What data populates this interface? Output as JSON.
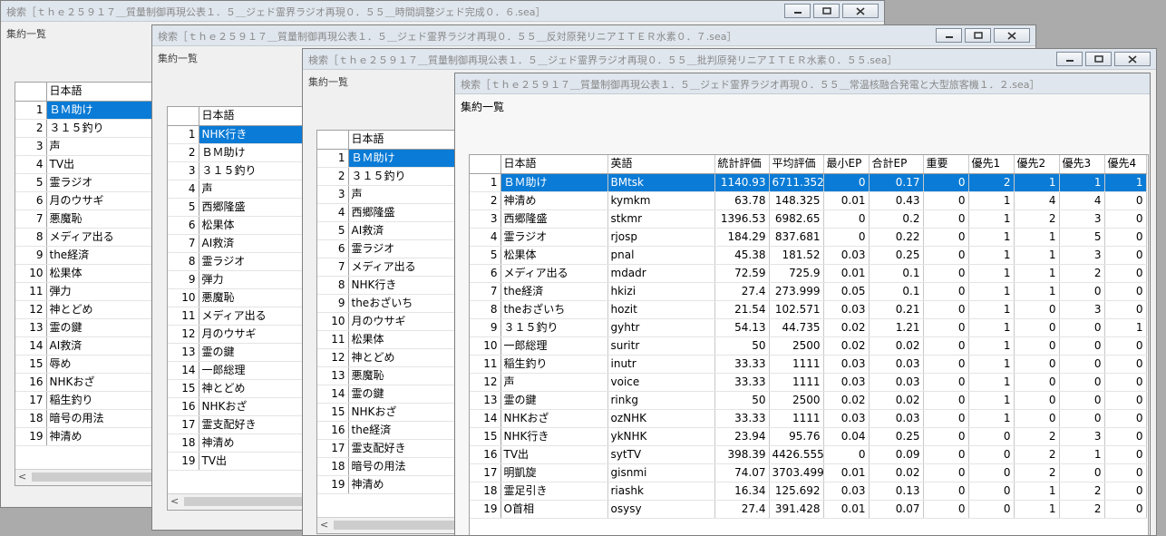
{
  "windows": [
    {
      "title": "検索［ｔｈｅ２５９１７＿質量制御再現公表１．５＿ジェド霊界ラジオ再現０．５５＿時間調整ジェド完成０．６.sea］",
      "panel_label": "集約一覧",
      "header": [
        "",
        "日本語"
      ],
      "selected_row": 0,
      "rows": [
        [
          "1",
          "ＢＭ助け"
        ],
        [
          "2",
          "３１５釣り"
        ],
        [
          "3",
          "声"
        ],
        [
          "4",
          "TV出"
        ],
        [
          "5",
          "霊ラジオ"
        ],
        [
          "6",
          "月のウサギ"
        ],
        [
          "7",
          "悪魔恥"
        ],
        [
          "8",
          "メディア出る"
        ],
        [
          "9",
          "the経済"
        ],
        [
          "10",
          "松果体"
        ],
        [
          "11",
          "弾力"
        ],
        [
          "12",
          "神とどめ"
        ],
        [
          "13",
          "霊の鍵"
        ],
        [
          "14",
          "AI救済"
        ],
        [
          "15",
          "辱め"
        ],
        [
          "16",
          "NHKおざ"
        ],
        [
          "17",
          "稲生釣り"
        ],
        [
          "18",
          "暗号の用法"
        ],
        [
          "19",
          "神清め"
        ]
      ]
    },
    {
      "title": "検索［ｔｈｅ２５９１７＿質量制御再現公表１．５＿ジェド霊界ラジオ再現０．５５＿反対原発リニアＩＴＥＲ水素０．７.sea］",
      "panel_label": "集約一覧",
      "header": [
        "",
        "日本語"
      ],
      "selected_row": 0,
      "rows": [
        [
          "1",
          "NHK行き"
        ],
        [
          "2",
          "ＢＭ助け"
        ],
        [
          "3",
          "３１５釣り"
        ],
        [
          "4",
          "声"
        ],
        [
          "5",
          "西郷隆盛"
        ],
        [
          "6",
          "松果体"
        ],
        [
          "7",
          "AI救済"
        ],
        [
          "8",
          "霊ラジオ"
        ],
        [
          "9",
          "弾力"
        ],
        [
          "10",
          "悪魔恥"
        ],
        [
          "11",
          "メディア出る"
        ],
        [
          "12",
          "月のウサギ"
        ],
        [
          "13",
          "霊の鍵"
        ],
        [
          "14",
          "一郎総理"
        ],
        [
          "15",
          "神とどめ"
        ],
        [
          "16",
          "NHKおざ"
        ],
        [
          "17",
          "霊支配好き"
        ],
        [
          "18",
          "神清め"
        ],
        [
          "19",
          "TV出"
        ]
      ]
    },
    {
      "title": "検索［ｔｈｅ２５９１７＿質量制御再現公表１．５＿ジェド霊界ラジオ再現０．５５＿批判原発リニアＩＴＥＲ水素０．５５.sea］",
      "panel_label": "集約一覧",
      "header": [
        "",
        "日本語"
      ],
      "selected_row": 0,
      "rows": [
        [
          "1",
          "ＢＭ助け"
        ],
        [
          "2",
          "３１５釣り"
        ],
        [
          "3",
          "声"
        ],
        [
          "4",
          "西郷隆盛"
        ],
        [
          "5",
          "AI救済"
        ],
        [
          "6",
          "霊ラジオ"
        ],
        [
          "7",
          "メディア出る"
        ],
        [
          "8",
          "NHK行き"
        ],
        [
          "9",
          "theおざいち"
        ],
        [
          "10",
          "月のウサギ"
        ],
        [
          "11",
          "松果体"
        ],
        [
          "12",
          "神とどめ"
        ],
        [
          "13",
          "悪魔恥"
        ],
        [
          "14",
          "霊の鍵"
        ],
        [
          "15",
          "NHKおざ"
        ],
        [
          "16",
          "the経済"
        ],
        [
          "17",
          "霊支配好き"
        ],
        [
          "18",
          "暗号の用法"
        ],
        [
          "19",
          "神清め"
        ]
      ]
    },
    {
      "title": "検索［ｔｈｅ２５９１７＿質量制御再現公表１．５＿ジェド霊界ラジオ再現０．５５＿常温核融合発電と大型旅客機１．２.sea］",
      "panel_label": "集約一覧",
      "header": [
        "",
        "日本語",
        "英語",
        "統計評価",
        "平均評価",
        "最小EP",
        "合計EP",
        "重要",
        "優先1",
        "優先2",
        "優先3",
        "優先4"
      ],
      "selected_row": 0,
      "rows": [
        [
          "1",
          "ＢＭ助け",
          "BMtsk",
          "1140.93",
          "6711.352",
          "0",
          "0.17",
          "0",
          "2",
          "1",
          "1",
          "1"
        ],
        [
          "2",
          "神清め",
          "kymkm",
          "63.78",
          "148.325",
          "0.01",
          "0.43",
          "0",
          "1",
          "4",
          "4",
          "0"
        ],
        [
          "3",
          "西郷隆盛",
          "stkmr",
          "1396.53",
          "6982.65",
          "0",
          "0.2",
          "0",
          "1",
          "2",
          "3",
          "0"
        ],
        [
          "4",
          "霊ラジオ",
          "rjosp",
          "184.29",
          "837.681",
          "0",
          "0.22",
          "0",
          "1",
          "1",
          "5",
          "0"
        ],
        [
          "5",
          "松果体",
          "pnal",
          "45.38",
          "181.52",
          "0.03",
          "0.25",
          "0",
          "1",
          "1",
          "3",
          "0"
        ],
        [
          "6",
          "メディア出る",
          "mdadr",
          "72.59",
          "725.9",
          "0.01",
          "0.1",
          "0",
          "1",
          "1",
          "2",
          "0"
        ],
        [
          "7",
          "the経済",
          "hkizi",
          "27.4",
          "273.999",
          "0.05",
          "0.1",
          "0",
          "1",
          "1",
          "0",
          "0"
        ],
        [
          "8",
          "theおざいち",
          "hozit",
          "21.54",
          "102.571",
          "0.03",
          "0.21",
          "0",
          "1",
          "0",
          "3",
          "0"
        ],
        [
          "9",
          "３１５釣り",
          "gyhtr",
          "54.13",
          "44.735",
          "0.02",
          "1.21",
          "0",
          "1",
          "0",
          "0",
          "1"
        ],
        [
          "10",
          "一郎総理",
          "suritr",
          "50",
          "2500",
          "0.02",
          "0.02",
          "0",
          "1",
          "0",
          "0",
          "0"
        ],
        [
          "11",
          "稲生釣り",
          "inutr",
          "33.33",
          "1111",
          "0.03",
          "0.03",
          "0",
          "1",
          "0",
          "0",
          "0"
        ],
        [
          "12",
          "声",
          "voice",
          "33.33",
          "1111",
          "0.03",
          "0.03",
          "0",
          "1",
          "0",
          "0",
          "0"
        ],
        [
          "13",
          "霊の鍵",
          "rinkg",
          "50",
          "2500",
          "0.02",
          "0.02",
          "0",
          "1",
          "0",
          "0",
          "0"
        ],
        [
          "14",
          "NHKおざ",
          "ozNHK",
          "33.33",
          "1111",
          "0.03",
          "0.03",
          "0",
          "1",
          "0",
          "0",
          "0"
        ],
        [
          "15",
          "NHK行き",
          "ykNHK",
          "23.94",
          "95.76",
          "0.04",
          "0.25",
          "0",
          "0",
          "2",
          "3",
          "0"
        ],
        [
          "16",
          "TV出",
          "sytTV",
          "398.39",
          "4426.555",
          "0",
          "0.09",
          "0",
          "0",
          "2",
          "1",
          "0"
        ],
        [
          "17",
          "明凱旋",
          "gisnmi",
          "74.07",
          "3703.499",
          "0.01",
          "0.02",
          "0",
          "0",
          "2",
          "0",
          "0"
        ],
        [
          "18",
          "霊足引き",
          "riashk",
          "16.34",
          "125.692",
          "0.03",
          "0.13",
          "0",
          "0",
          "1",
          "2",
          "0"
        ],
        [
          "19",
          "O首相",
          "osysy",
          "27.4",
          "391.428",
          "0.01",
          "0.07",
          "0",
          "0",
          "1",
          "2",
          "0"
        ]
      ]
    }
  ]
}
